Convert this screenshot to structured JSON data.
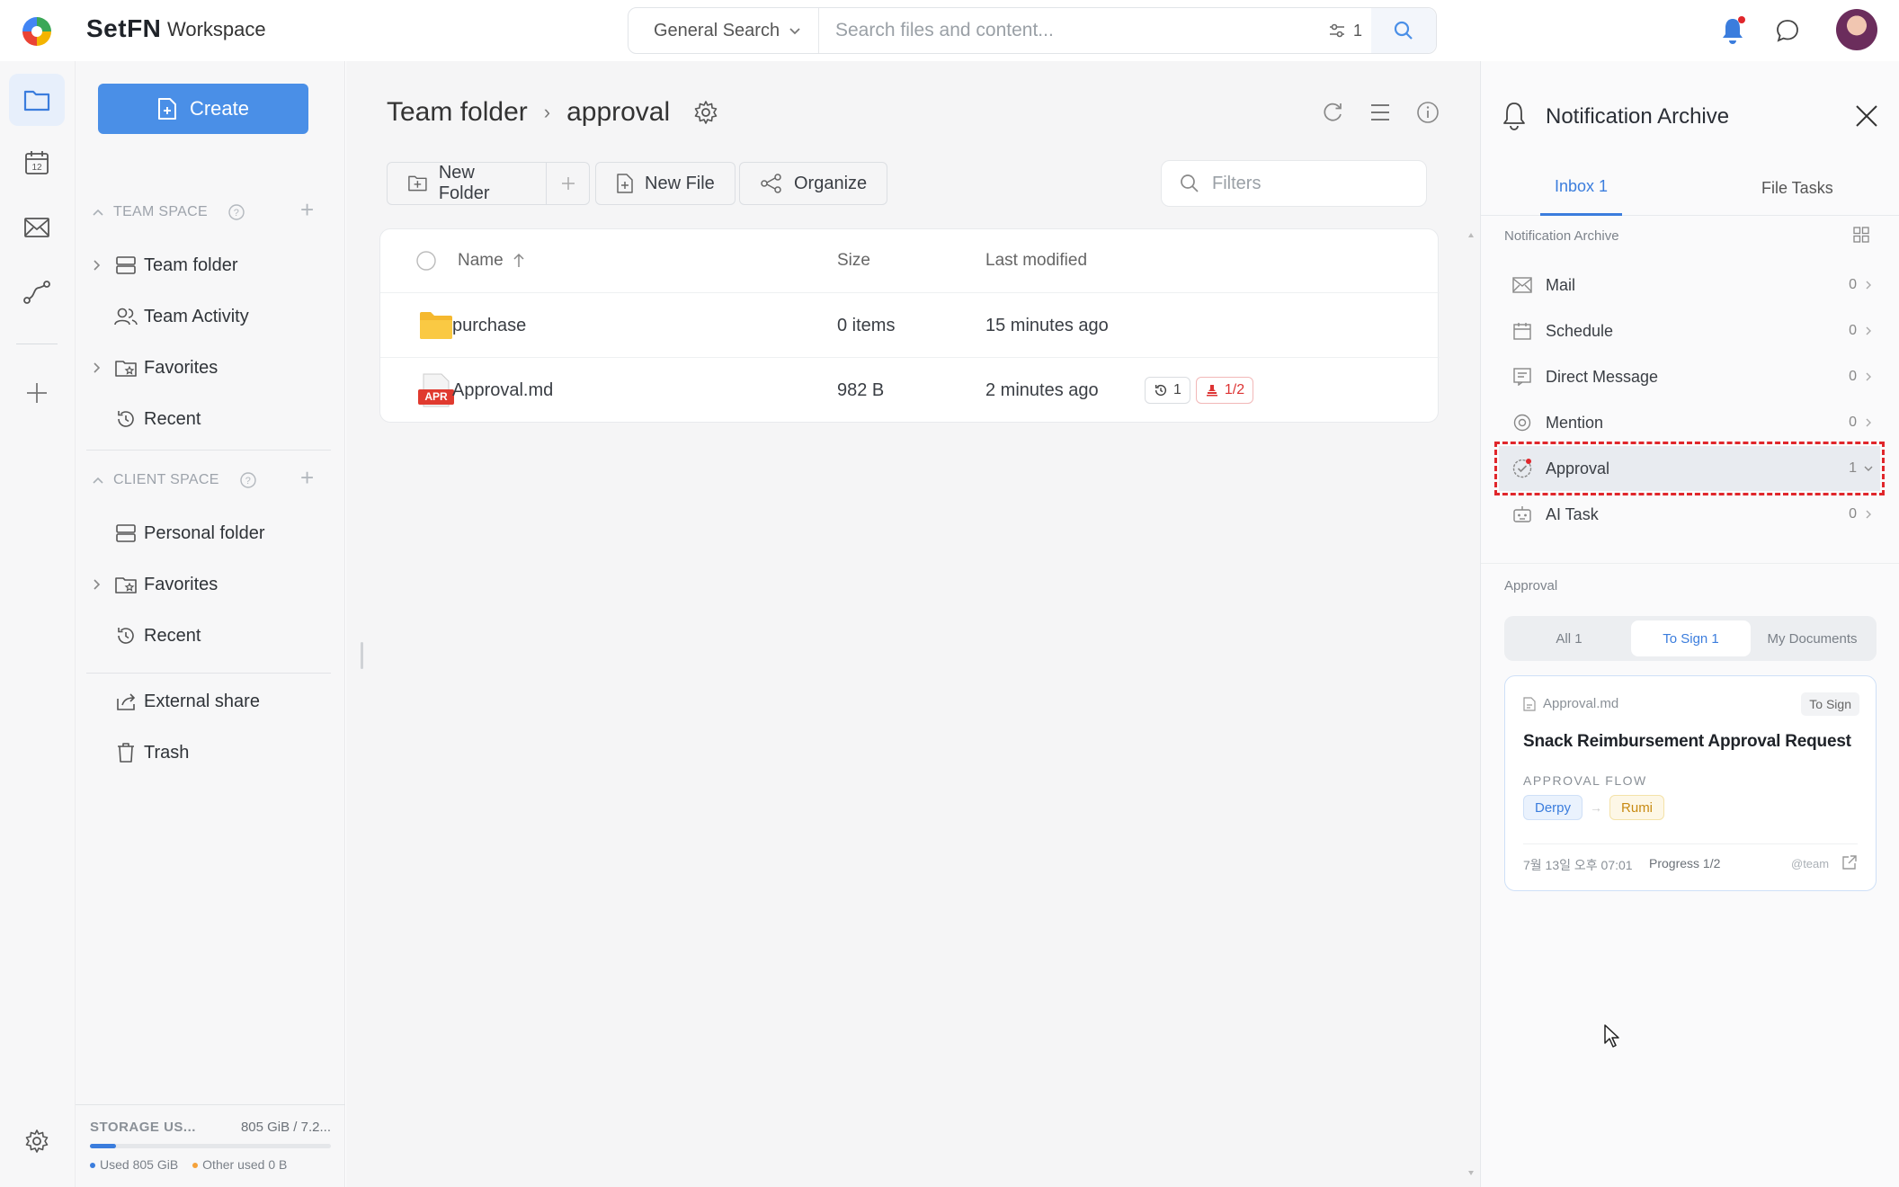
{
  "app": {
    "logo_text": "SetFN",
    "workspace_label": "Workspace"
  },
  "search": {
    "type_label": "General Search",
    "placeholder": "Search files and content...",
    "filter_count": "1"
  },
  "leftnav": {
    "create_label": "Create",
    "team_space_label": "TEAM SPACE",
    "team_items": [
      {
        "label": "Team folder"
      },
      {
        "label": "Team Activity"
      },
      {
        "label": "Favorites"
      },
      {
        "label": "Recent"
      }
    ],
    "client_space_label": "CLIENT SPACE",
    "client_items": [
      {
        "label": "Personal folder"
      },
      {
        "label": "Favorites"
      },
      {
        "label": "Recent"
      }
    ],
    "extra_items": [
      {
        "label": "External share"
      },
      {
        "label": "Trash"
      }
    ],
    "storage": {
      "label": "STORAGE US...",
      "value": "805 GiB / 7.2...",
      "used_label": "Used 805 GiB",
      "other_label": "Other used 0 B",
      "used_fraction": 0.11
    }
  },
  "main": {
    "breadcrumb": [
      "Team folder",
      "approval"
    ],
    "toolbar": {
      "new_folder": "New Folder",
      "new_file": "New File",
      "organize": "Organize",
      "filters_placeholder": "Filters"
    },
    "table": {
      "headers": {
        "name": "Name",
        "size": "Size",
        "modified": "Last modified"
      },
      "rows": [
        {
          "name": "purchase",
          "size": "0 items",
          "modified": "15 minutes ago"
        },
        {
          "name": "Approval.md",
          "file_badge": "APR",
          "size": "982 B",
          "modified": "2 minutes ago",
          "versions": "1",
          "signatures": "1/2"
        }
      ]
    }
  },
  "rpanel": {
    "title": "Notification Archive",
    "tabs": {
      "inbox": "Inbox 1",
      "file_tasks": "File Tasks"
    },
    "section_label": "Notification Archive",
    "categories": [
      {
        "label": "Mail",
        "count": "0"
      },
      {
        "label": "Schedule",
        "count": "0"
      },
      {
        "label": "Direct Message",
        "count": "0"
      },
      {
        "label": "Mention",
        "count": "0"
      },
      {
        "label": "Approval",
        "count": "1"
      },
      {
        "label": "AI Task",
        "count": "0"
      }
    ],
    "approval_label": "Approval",
    "segments": {
      "all": "All 1",
      "to_sign": "To Sign 1",
      "my_docs": "My Documents"
    },
    "card": {
      "file": "Approval.md",
      "status": "To Sign",
      "title": "Snack Reimbursement Approval Request",
      "flow_label": "APPROVAL FLOW",
      "flow_from": "Derpy",
      "flow_to": "Rumi",
      "time": "7월 13일 오후 07:01",
      "progress": "Progress 1/2",
      "team": "@team"
    }
  },
  "colors": {
    "accent": "#3b7ddd",
    "primary_button": "#4a8fe7",
    "highlight": "#e0262b",
    "folder": "#f5b82e"
  }
}
